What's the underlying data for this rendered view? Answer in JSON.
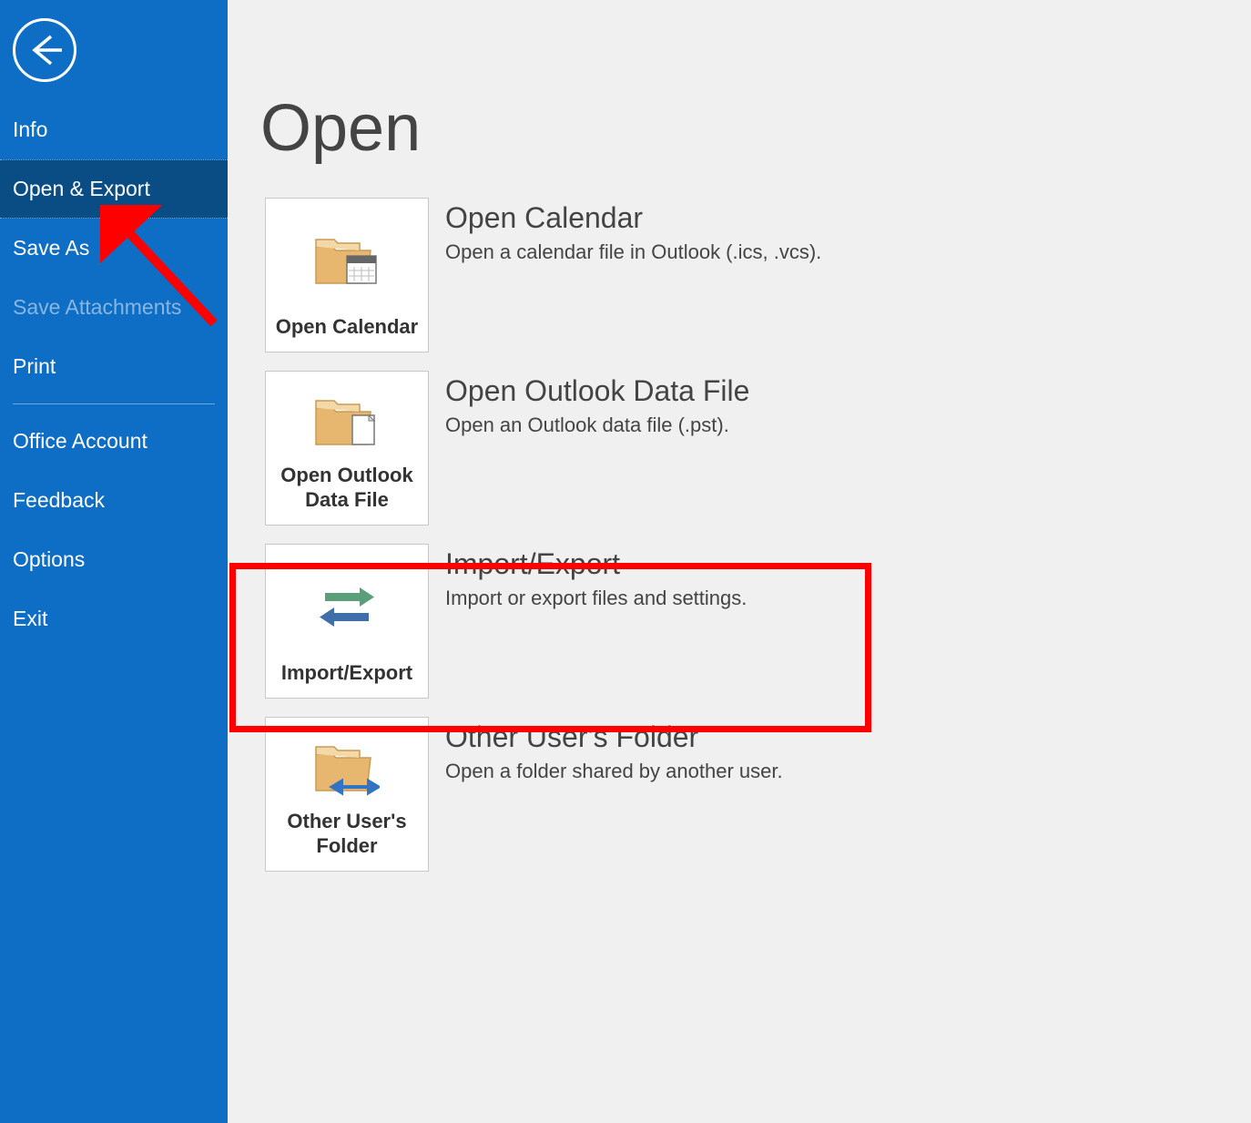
{
  "sidebar": {
    "items": [
      {
        "label": "Info",
        "active": false,
        "disabled": false
      },
      {
        "label": "Open & Export",
        "active": true,
        "disabled": false
      },
      {
        "label": "Save As",
        "active": false,
        "disabled": false
      },
      {
        "label": "Save Attachments",
        "active": false,
        "disabled": true
      },
      {
        "label": "Print",
        "active": false,
        "disabled": false
      }
    ],
    "bottom_items": [
      {
        "label": "Office Account"
      },
      {
        "label": "Feedback"
      },
      {
        "label": "Options"
      },
      {
        "label": "Exit"
      }
    ]
  },
  "page": {
    "title": "Open"
  },
  "options": [
    {
      "button_label": "Open Calendar",
      "title": "Open Calendar",
      "desc": "Open a calendar file in Outlook (.ics, .vcs).",
      "icon": "calendar-folder-icon"
    },
    {
      "button_label": "Open Outlook Data File",
      "title": "Open Outlook Data File",
      "desc": "Open an Outlook data file (.pst).",
      "icon": "data-file-folder-icon"
    },
    {
      "button_label": "Import/Export",
      "title": "Import/Export",
      "desc": "Import or export files and settings.",
      "icon": "import-export-icon"
    },
    {
      "button_label": "Other User's Folder",
      "title": "Other User's Folder",
      "desc": "Open a folder shared by another user.",
      "icon": "shared-folder-icon"
    }
  ]
}
